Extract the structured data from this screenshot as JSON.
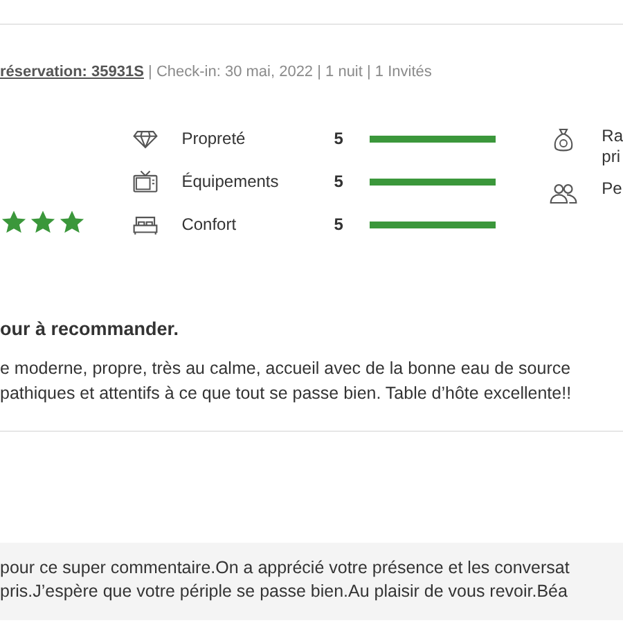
{
  "booking": {
    "reservation": "réservation: 35931S",
    "separator": "|",
    "checkin": "Check-in: 30 mai, 2022 | 1 nuit | 1 Invités"
  },
  "rating": {
    "stars": 3
  },
  "categories": [
    {
      "label": "Propreté",
      "score": "5",
      "level": 1
    },
    {
      "label": "Équipements",
      "score": "5",
      "level": 1
    },
    {
      "label": "Confort",
      "score": "5",
      "level": 1
    }
  ],
  "categories_right": [
    {
      "lines": [
        "Ra",
        "pri"
      ]
    },
    {
      "lines": [
        "Pe"
      ]
    }
  ],
  "review": {
    "title": "our à recommander.",
    "lines": [
      "e moderne, propre, très au calme, accueil avec de la bonne eau de source",
      "pathiques et attentifs à ce que tout se passe bien. Table d’hôte excellente!!"
    ]
  },
  "reply": {
    "lines": [
      "pour ce super commentaire.On a apprécié votre présence et les conversat",
      "pris.J’espère que votre périple se passe bien.Au plaisir de vous revoir.Béa"
    ]
  }
}
